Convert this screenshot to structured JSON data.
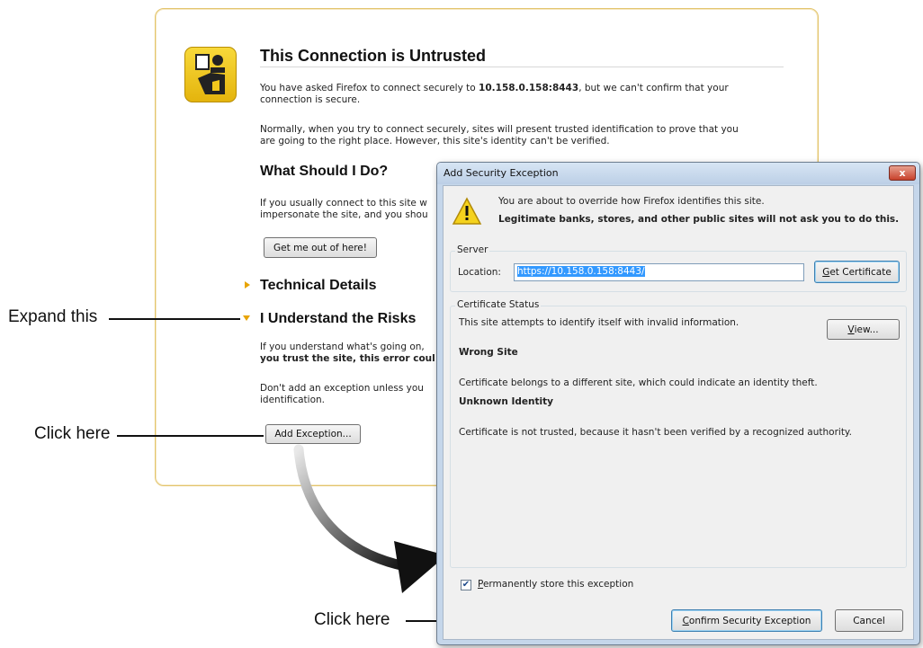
{
  "error_page": {
    "title": "This Connection is Untrusted",
    "intro_prefix": "You have asked Firefox to connect securely to ",
    "intro_host": "10.158.0.158:8443",
    "intro_suffix": ", but we can't confirm that your",
    "intro_line2": "connection is secure.",
    "para2_line1": "Normally, when you try to connect securely, sites will present trusted identification to prove that you",
    "para2_line2": "are going to the right place. However, this site's identity can't be verified.",
    "what_heading": "What Should I Do?",
    "what_line1": "If you usually connect to this site w",
    "what_line2": "impersonate the site, and you shou",
    "get_out_button": "Get me out of here!",
    "technical_details": "Technical Details",
    "understand_risks": "I Understand the Risks",
    "risks_line1": "If you understand what's going on,",
    "risks_line2": "you trust the site, this error coul",
    "dont_line1": "Don't add an exception unless you",
    "dont_line2": "identification.",
    "add_exception_button": "Add Exception..."
  },
  "dialog": {
    "title": "Add Security Exception",
    "close_label": "x",
    "warning_line1": "You are about to override how Firefox identifies this site.",
    "warning_line2": "Legitimate banks, stores, and other public sites will not ask you to do this.",
    "server_group": "Server",
    "location_label": "Location:",
    "location_value": "https://10.158.0.158:8443/",
    "get_certificate_prefix": "G",
    "get_certificate_rest": "et Certificate",
    "cert_status_group": "Certificate Status",
    "status_line": "This site attempts to identify itself with invalid information.",
    "view_prefix": "V",
    "view_rest": "iew...",
    "wrong_site_heading": "Wrong Site",
    "wrong_site_text": "Certificate belongs to a different site, which could indicate an identity theft.",
    "unknown_identity_heading": "Unknown Identity",
    "unknown_identity_text": "Certificate is not trusted, because it hasn't been verified by a recognized authority.",
    "permanent_prefix": "P",
    "permanent_rest": "ermanently store this exception",
    "permanent_checked": true,
    "confirm_prefix": "C",
    "confirm_rest": "onfirm Security Exception",
    "cancel_button": "Cancel"
  },
  "annotations": {
    "expand": "Expand this",
    "click1": "Click here",
    "click2": "Click here"
  },
  "colors": {
    "accent_orange": "#e8a400",
    "selection_blue": "#3399ff",
    "close_red": "#c8412b"
  }
}
